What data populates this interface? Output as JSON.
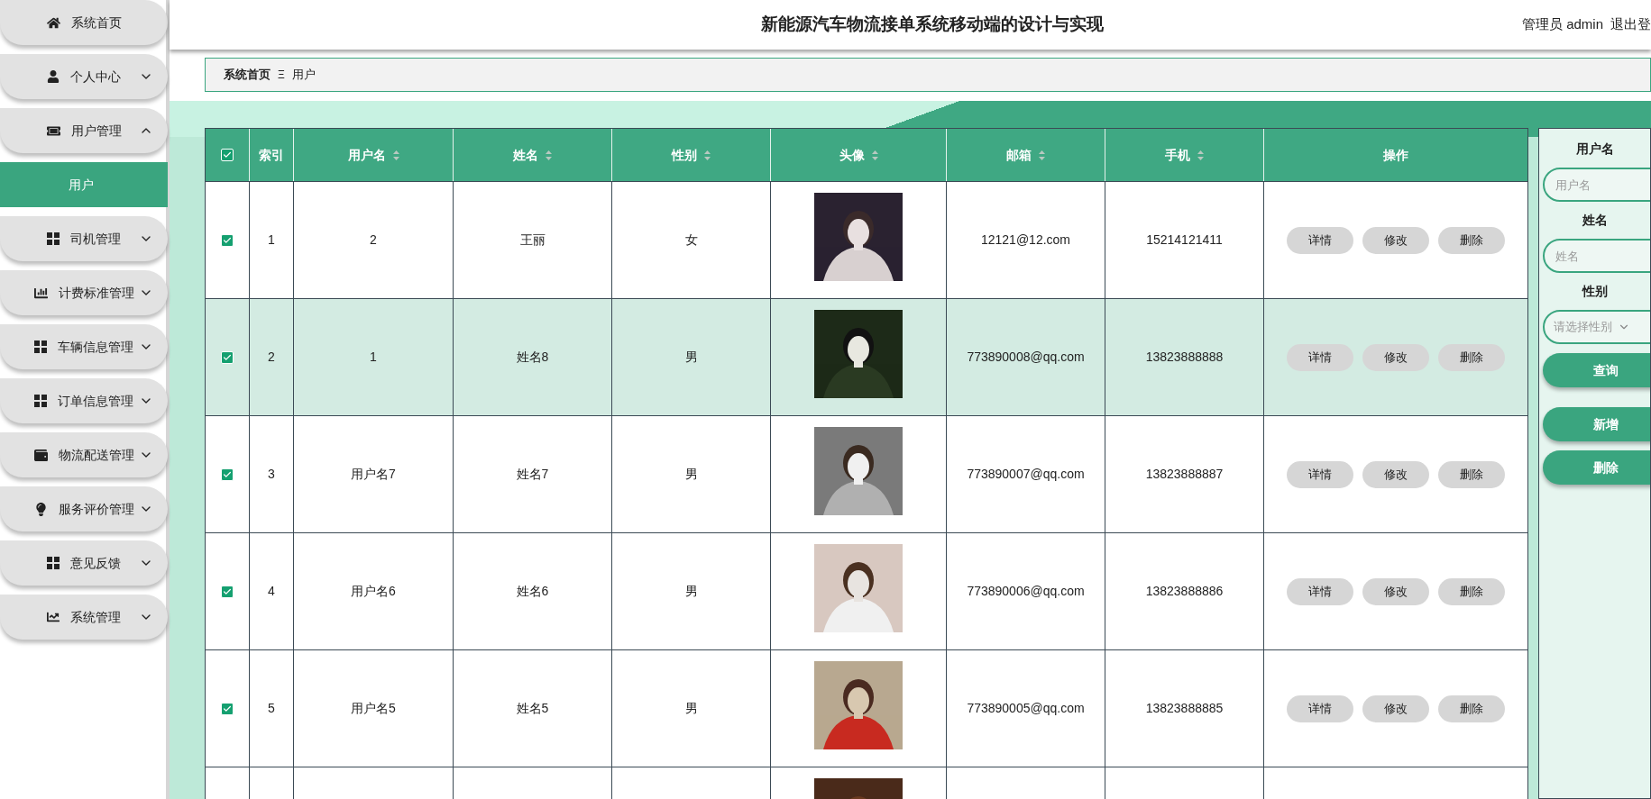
{
  "sidebar": {
    "items": [
      {
        "label": "系统首页",
        "kind": "link"
      },
      {
        "label": "个人中心",
        "kind": "menu",
        "expanded": false
      },
      {
        "label": "用户管理",
        "kind": "menu",
        "expanded": true,
        "children": [
          {
            "label": "用户",
            "selected": true
          }
        ]
      },
      {
        "label": "司机管理",
        "kind": "menu",
        "expanded": false
      },
      {
        "label": "计费标准管理",
        "kind": "menu",
        "expanded": false
      },
      {
        "label": "车辆信息管理",
        "kind": "menu",
        "expanded": false
      },
      {
        "label": "订单信息管理",
        "kind": "menu",
        "expanded": false
      },
      {
        "label": "物流配送管理",
        "kind": "menu",
        "expanded": false
      },
      {
        "label": "服务评价管理",
        "kind": "menu",
        "expanded": false
      },
      {
        "label": "意见反馈",
        "kind": "menu",
        "expanded": false
      },
      {
        "label": "系统管理",
        "kind": "menu",
        "expanded": false
      }
    ]
  },
  "header": {
    "title": "新能源汽车物流接单系统移动端的设计与实现",
    "user": "管理员 admin",
    "logout": "退出登"
  },
  "breadcrumb": {
    "home": "系统首页",
    "separator": "Ξ",
    "current": "用户"
  },
  "table": {
    "all_checked": true,
    "columns": [
      {
        "label": "索引",
        "sortable": false
      },
      {
        "label": "用户名",
        "sortable": true
      },
      {
        "label": "姓名",
        "sortable": true
      },
      {
        "label": "性别",
        "sortable": true
      },
      {
        "label": "头像",
        "sortable": true
      },
      {
        "label": "邮箱",
        "sortable": true
      },
      {
        "label": "手机",
        "sortable": true
      },
      {
        "label": "操作",
        "sortable": false
      }
    ],
    "rows": [
      {
        "kind": "full",
        "checked": true,
        "selected": false,
        "index": "1",
        "username": "2",
        "name": "王丽",
        "gender": "女",
        "email": "12121@12.com",
        "phone": "15214121411",
        "actions": [
          "详情",
          "修改",
          "删除"
        ]
      },
      {
        "kind": "full",
        "checked": true,
        "selected": true,
        "index": "2",
        "username": "1",
        "name": "姓名8",
        "gender": "男",
        "email": "773890008@qq.com",
        "phone": "13823888888",
        "actions": [
          "详情",
          "修改",
          "删除"
        ]
      },
      {
        "kind": "full",
        "checked": true,
        "selected": false,
        "index": "3",
        "username": "用户名7",
        "name": "姓名7",
        "gender": "男",
        "email": "773890007@qq.com",
        "phone": "13823888887",
        "actions": [
          "详情",
          "修改",
          "删除"
        ]
      },
      {
        "kind": "full",
        "checked": true,
        "selected": false,
        "index": "4",
        "username": "用户名6",
        "name": "姓名6",
        "gender": "男",
        "email": "773890006@qq.com",
        "phone": "13823888886",
        "actions": [
          "详情",
          "修改",
          "删除"
        ]
      },
      {
        "kind": "full",
        "checked": true,
        "selected": false,
        "index": "5",
        "username": "用户名5",
        "name": "姓名5",
        "gender": "男",
        "email": "773890005@qq.com",
        "phone": "13823888885",
        "actions": [
          "详情",
          "修改",
          "删除"
        ]
      },
      {
        "kind": "partial",
        "selected": false
      }
    ]
  },
  "search": {
    "fields": [
      {
        "kind": "text",
        "label": "用户名",
        "placeholder": "用户名"
      },
      {
        "kind": "text",
        "label": "姓名",
        "placeholder": "姓名"
      },
      {
        "kind": "select",
        "label": "性别",
        "placeholder": "请选择性别"
      }
    ],
    "buttons": [
      "查询",
      "新增",
      "删除"
    ]
  }
}
